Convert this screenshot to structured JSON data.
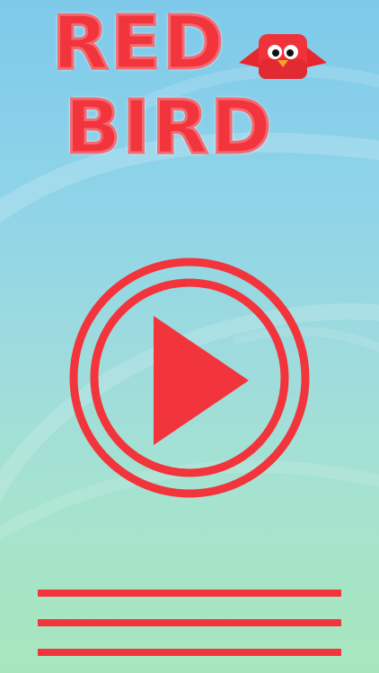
{
  "game": {
    "title_line1": "RED",
    "title_line2": "BIRD",
    "logo_icon": "red-bird-icon",
    "play_icon": "play-icon",
    "menu_icon": "hamburger-menu-icon"
  },
  "colors": {
    "accent_red": "#f2353c",
    "sky_top": "#7ec9ea",
    "sky_bottom": "#a7e6bd"
  }
}
